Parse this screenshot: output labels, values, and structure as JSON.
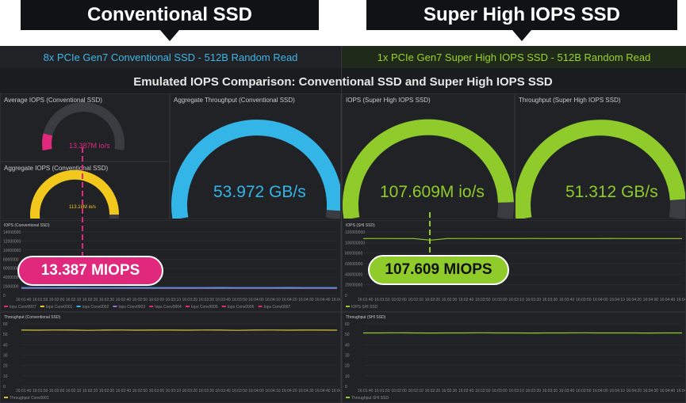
{
  "callouts": {
    "left": "Conventional SSD",
    "right": "Super High IOPS SSD"
  },
  "headers": {
    "left": "8x PCIe Gen7 Conventional SSD - 512B Random Read",
    "right": "1x PCIe Gen7 Super High IOPS SSD - 512B Random Read"
  },
  "main_title": "Emulated IOPS Comparison: Conventional SSD and Super High IOPS SSD",
  "colors": {
    "pink": "#e0287d",
    "yellow": "#f2c81c",
    "blue": "#33b5e8",
    "green": "#8fcb2b",
    "bg": "#1b1c20"
  },
  "panels": {
    "avg_iops": {
      "title": "Average IOPS (Conventional SSD)",
      "value": "13.387M io/s",
      "fraction": 0.12
    },
    "agg_iops": {
      "title": "Aggregate IOPS (Conventional SSD)",
      "value": "113.18M io/s",
      "fraction": 0.95
    },
    "agg_throughput": {
      "title": "Aggregate Throughput (Conventional SSD)",
      "value": "53.972 GB/s",
      "fraction": 0.97
    },
    "iops_shi": {
      "title": "IOPS (Super High IOPS SSD)",
      "value": "107.609M io/s",
      "fraction": 0.94
    },
    "throughput_shi": {
      "title": "Throughput (Super High IOPS SSD)",
      "value": "51.312 GB/s",
      "fraction": 0.93
    },
    "iops_conv_chart": {
      "title": "IOPS (Conventional SSD)"
    },
    "iops_shi_chart": {
      "title": "IOPS (SHI SSD)"
    },
    "tp_conv_chart": {
      "title": "Throughput (Conventional SSD)"
    },
    "tp_shi_chart": {
      "title": "Throughput (SHI SSD)"
    }
  },
  "pills": {
    "left": "13.387 MIOPS",
    "right": "107.609 MIOPS"
  },
  "time_ticks": [
    "16:01:40",
    "16:01:50",
    "16:02:00",
    "16:02:10",
    "16:02:20",
    "16:02:30",
    "16:02:40",
    "16:02:50",
    "16:03:00",
    "16:03:10",
    "16:03:20",
    "16:03:30",
    "16:03:40",
    "16:03:50",
    "16:04:00",
    "16:04:10",
    "16:04:20",
    "16:04:30",
    "16:04:40",
    "16:04:50"
  ],
  "legends": {
    "iops_conv": [
      "Iops Conv0007",
      "Iops Conv0001",
      "Iops Conv0002",
      "Iops Conv0003",
      "Iops Conv0004",
      "Iops Conv0005",
      "Iops Conv0006",
      "Iops Conv0007"
    ],
    "iops_shi": [
      "IOPS SHI SSD"
    ],
    "tp_conv": [
      "Throughput Conv0001"
    ],
    "tp_shi": [
      "Throughput SHI SSD"
    ]
  },
  "chart_data": [
    {
      "type": "line",
      "panel": "iops_conv_chart",
      "ylim": [
        0,
        14000000
      ],
      "series": [
        {
          "name": "Iops Conv0007",
          "color": "#e0287d",
          "values": [
            1650000,
            1660000,
            1650000,
            1640000,
            1670000,
            1650000,
            1660000,
            1650000,
            1640000,
            1650000,
            1660000,
            1650000,
            1670000,
            1650000,
            1640000,
            1650000,
            1660000,
            1650000,
            1650000,
            1660000
          ]
        },
        {
          "name": "Iops Conv0001",
          "color": "#f2c81c",
          "values": [
            1600000,
            1610000,
            1600000,
            1620000,
            1600000,
            1590000,
            1610000,
            1600000,
            1620000,
            1600000,
            1610000,
            1600000,
            1590000,
            1610000,
            1600000,
            1620000,
            1600000,
            1610000,
            1600000,
            1600000
          ]
        },
        {
          "name": "Iops Conv0002",
          "color": "#33b5e8",
          "values": [
            1700000,
            1690000,
            1700000,
            1710000,
            1690000,
            1700000,
            1700000,
            1710000,
            1690000,
            1700000,
            1690000,
            1700000,
            1710000,
            1700000,
            1690000,
            1700000,
            1710000,
            1700000,
            1690000,
            1700000
          ]
        },
        {
          "name": "Iops Conv0003",
          "color": "#9b6fd6",
          "values": [
            1550000,
            1560000,
            1550000,
            1540000,
            1560000,
            1550000,
            1550000,
            1560000,
            1540000,
            1550000,
            1560000,
            1550000,
            1540000,
            1550000,
            1560000,
            1550000,
            1540000,
            1550000,
            1560000,
            1550000
          ]
        }
      ]
    },
    {
      "type": "line",
      "panel": "iops_shi_chart",
      "ylim": [
        0,
        120000000
      ],
      "series": [
        {
          "name": "IOPS SHI SSD",
          "color": "#8fcb2b",
          "values": [
            107600000,
            107700000,
            107500000,
            107600000,
            104500000,
            107600000,
            107700000,
            107600000,
            107500000,
            107600000,
            107700000,
            107600000,
            107600000,
            107500000,
            107600000,
            107700000,
            107600000,
            107600000,
            107500000,
            107600000
          ]
        }
      ]
    },
    {
      "type": "line",
      "panel": "tp_conv_chart",
      "ylim": [
        0,
        60
      ],
      "series": [
        {
          "name": "Throughput Conv0001",
          "color": "#d9c23a",
          "values": [
            54.0,
            53.9,
            54.1,
            54.0,
            53.8,
            54.0,
            54.1,
            53.9,
            54.0,
            54.0,
            53.9,
            54.1,
            54.0,
            53.8,
            54.0,
            54.1,
            53.9,
            54.0,
            54.0,
            53.9
          ]
        }
      ]
    },
    {
      "type": "line",
      "panel": "tp_shi_chart",
      "ylim": [
        0,
        60
      ],
      "series": [
        {
          "name": "Throughput SHI SSD",
          "color": "#8fcb2b",
          "values": [
            51.3,
            51.3,
            51.4,
            51.3,
            51.2,
            51.3,
            51.3,
            51.4,
            51.3,
            51.3,
            51.2,
            51.3,
            51.3,
            51.4,
            51.3,
            51.3,
            51.3,
            51.2,
            51.3,
            51.3
          ]
        }
      ]
    }
  ]
}
